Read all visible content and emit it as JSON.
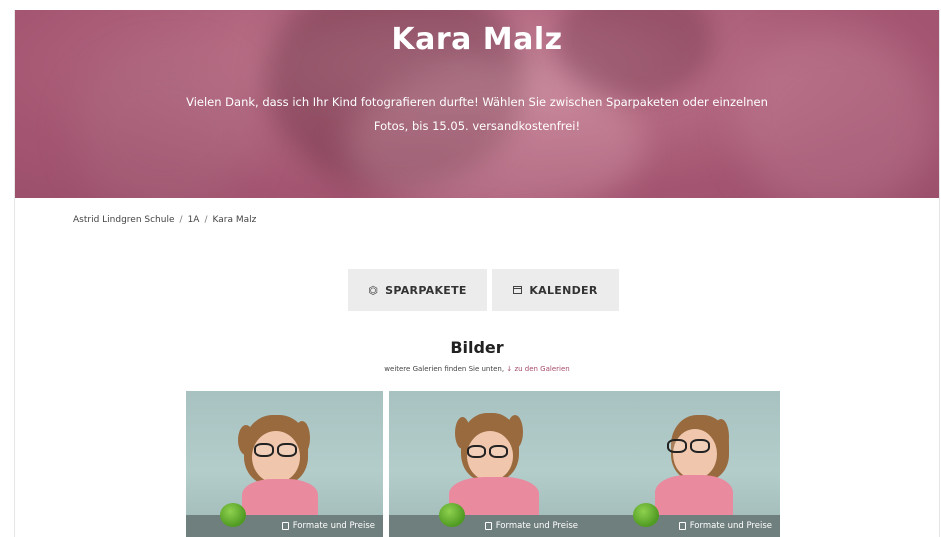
{
  "hero": {
    "title": "Kara Malz",
    "message": "Vielen Dank, dass ich Ihr Kind fotografieren durfte! Wählen Sie zwischen Sparpaketen oder einzelnen Fotos, bis 15.05. versandkostenfrei!"
  },
  "breadcrumb": {
    "items": [
      "Astrid Lindgren Schule",
      "1A",
      "Kara Malz"
    ],
    "separator": "/"
  },
  "buttons": {
    "sparpakete": {
      "label": "SPARPAKETE",
      "icon": "package-icon"
    },
    "kalender": {
      "label": "KALENDER",
      "icon": "calendar-icon"
    }
  },
  "section": {
    "title": "Bilder",
    "subtitle": "weitere Galerien finden Sie unten,",
    "link_arrow": "↓",
    "link_text": "zu den Galerien"
  },
  "gallery": {
    "tiles": [
      {
        "caption": "Formate und Preise",
        "icon": "bag-icon"
      },
      {
        "caption": "Formate und Preise",
        "icon": "bag-icon"
      },
      {
        "caption": "Formate und Preise",
        "icon": "bag-icon"
      }
    ]
  },
  "colors": {
    "hero_tint": "#a45571",
    "link": "#a64c6a",
    "button_bg": "#ececec"
  }
}
